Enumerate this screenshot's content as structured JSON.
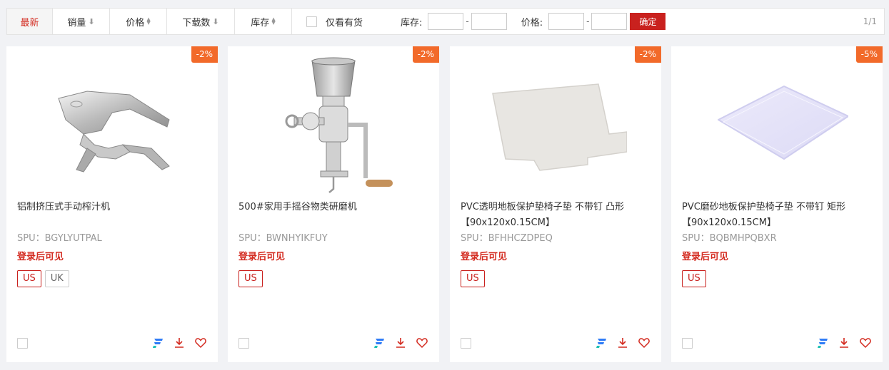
{
  "filter_bar": {
    "sort_items": [
      {
        "label": "最新",
        "arrow": ""
      },
      {
        "label": "销量",
        "arrow": "⬇"
      },
      {
        "label": "价格",
        "arrow": "updown"
      },
      {
        "label": "下载数",
        "arrow": "⬇"
      },
      {
        "label": "库存",
        "arrow": "updown"
      }
    ],
    "in_stock_label": "仅看有货",
    "stock_label": "库存:",
    "price_label": "价格:",
    "dash": "-",
    "confirm_label": "确定",
    "page_count": "1/1"
  },
  "products": [
    {
      "discount": "-2%",
      "title": "铝制挤压式手动榨汁机",
      "spu": "SPU：BGYLYUTPAL",
      "price": "登录后可见",
      "tags": [
        "US",
        "UK"
      ],
      "image": "juicer-image"
    },
    {
      "discount": "-2%",
      "title": "500#家用手摇谷物类研磨机",
      "spu": "SPU：BWNHYIKFUY",
      "price": "登录后可见",
      "tags": [
        "US"
      ],
      "image": "grain-mill-image"
    },
    {
      "discount": "-2%",
      "title": "PVC透明地板保护垫椅子垫 不带钉 凸形【90x120x0.15CM】",
      "spu": "SPU：BFHHCZDPEQ",
      "price": "登录后可见",
      "tags": [
        "US"
      ],
      "image": "chair-mat-lip-image"
    },
    {
      "discount": "-5%",
      "title": "PVC磨砂地板保护垫椅子垫 不带钉 矩形【90x120x0.15CM】",
      "spu": "SPU：BQBMHPQBXR",
      "price": "登录后可见",
      "tags": [
        "US"
      ],
      "image": "chair-mat-rect-image"
    }
  ],
  "colors": {
    "accent_red": "#c9211e",
    "discount_orange": "#f26a2a",
    "icon_blue": "#2f7cf6",
    "icon_red": "#d32a1f"
  }
}
